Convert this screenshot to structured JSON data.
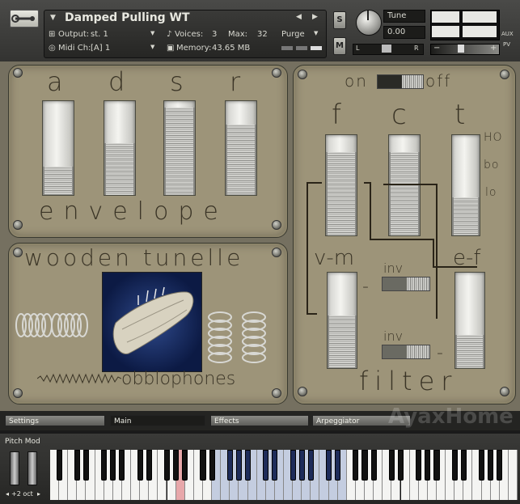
{
  "header": {
    "instrument_title": "Damped Pulling WT",
    "output_label": "Output:",
    "output_value": "st. 1",
    "voices_label": "Voices:",
    "voices_value": "3",
    "max_label": "Max:",
    "max_value": "32",
    "purge_label": "Purge",
    "midi_label": "Midi Ch:",
    "midi_value": "[A]  1",
    "memory_label": "Memory:",
    "memory_value": "43.65 MB",
    "solo_label": "S",
    "mute_label": "M",
    "tune_label": "Tune",
    "tune_value": "0.00",
    "pan_left": "L",
    "pan_right": "R",
    "aux_label": "AUX",
    "pv_label": "PV",
    "vol_minus": "−",
    "vol_plus": "+"
  },
  "envelope": {
    "letters": [
      "a",
      "d",
      "s",
      "r"
    ],
    "label": "envelope",
    "spring_levels": [
      0.3,
      0.55,
      0.93,
      0.75
    ]
  },
  "filter": {
    "on_label": "on",
    "off_label": "off",
    "letters": [
      "f",
      "c",
      "t"
    ],
    "type_options": [
      "HO",
      "bo",
      "lo"
    ],
    "vm_label": "v-m",
    "ef_label": "e-f",
    "inv_label": "inv",
    "dash": "-",
    "label": "filter",
    "spring_levels": [
      0.83,
      0.83,
      0.38,
      0.55,
      0.35
    ]
  },
  "instrument": {
    "title": "wooden tunelle",
    "brand": "obblophones"
  },
  "tabs": [
    "Settings",
    "Main",
    "Effects",
    "Arpeggiator"
  ],
  "active_tab": "Main",
  "watermark": "AyaxHome",
  "keyboard": {
    "pitch_mod_label": "Pitch Mod",
    "octave_label": "+2 oct",
    "arrow_left": "◂",
    "arrow_right": "▸"
  },
  "colors": {
    "wood": "#9d9479",
    "key_highlight": "#c4cde0",
    "key_pressed": "#e7a7aa"
  }
}
